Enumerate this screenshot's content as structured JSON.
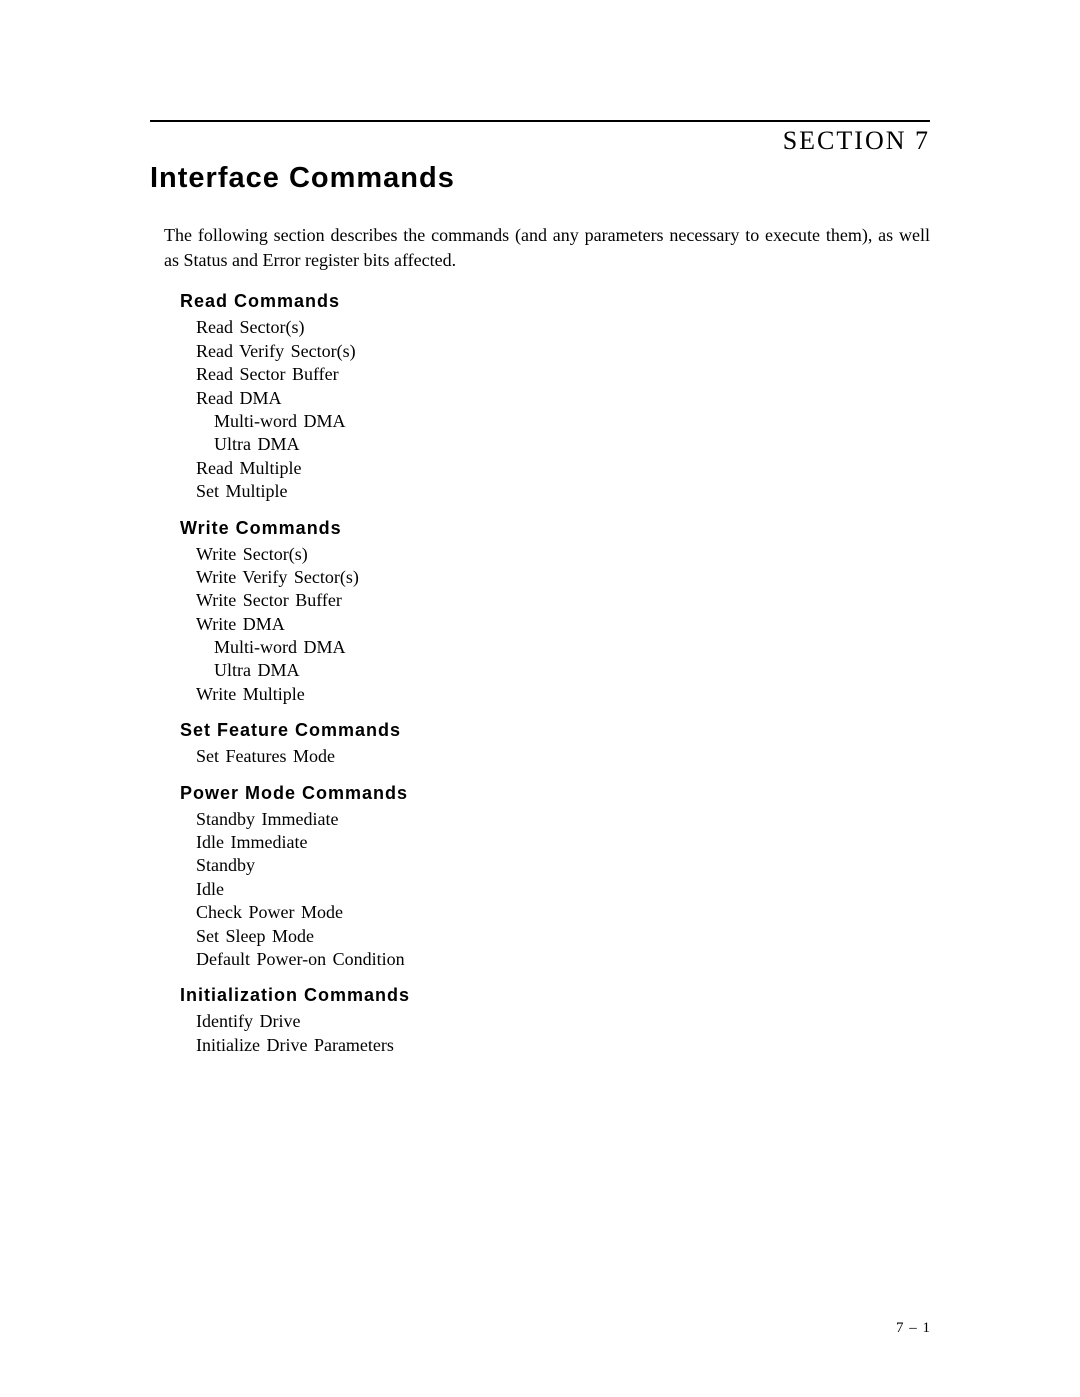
{
  "header": {
    "section_label": "SECTION 7",
    "title": "Interface Commands"
  },
  "intro": "The following section describes the commands (and any parameters necessary to execute them), as well as Status and Error register bits affected.",
  "groups": [
    {
      "title": "Read Commands",
      "items": [
        {
          "text": "Read Sector(s)"
        },
        {
          "text": "Read Verify Sector(s)"
        },
        {
          "text": "Read Sector Buffer"
        },
        {
          "text": "Read DMA"
        },
        {
          "text": "Multi-word DMA",
          "sub": true
        },
        {
          "text": "Ultra DMA",
          "sub": true
        },
        {
          "text": "Read Multiple"
        },
        {
          "text": "Set Multiple"
        }
      ]
    },
    {
      "title": "Write Commands",
      "items": [
        {
          "text": "Write Sector(s)"
        },
        {
          "text": "Write Verify Sector(s)"
        },
        {
          "text": "Write Sector Buffer"
        },
        {
          "text": "Write DMA"
        },
        {
          "text": "Multi-word DMA",
          "sub": true
        },
        {
          "text": "Ultra DMA",
          "sub": true
        },
        {
          "text": "Write Multiple"
        }
      ]
    },
    {
      "title": "Set Feature Commands",
      "items": [
        {
          "text": "Set Features Mode"
        }
      ]
    },
    {
      "title": "Power Mode Commands",
      "items": [
        {
          "text": "Standby Immediate"
        },
        {
          "text": "Idle Immediate"
        },
        {
          "text": "Standby"
        },
        {
          "text": "Idle"
        },
        {
          "text": "Check Power Mode"
        },
        {
          "text": "Set Sleep Mode"
        },
        {
          "text": "Default Power-on Condition"
        }
      ]
    },
    {
      "title": "Initialization Commands",
      "items": [
        {
          "text": "Identify Drive"
        },
        {
          "text": "Initialize Drive Parameters"
        }
      ]
    }
  ],
  "page_number": "7 – 1"
}
